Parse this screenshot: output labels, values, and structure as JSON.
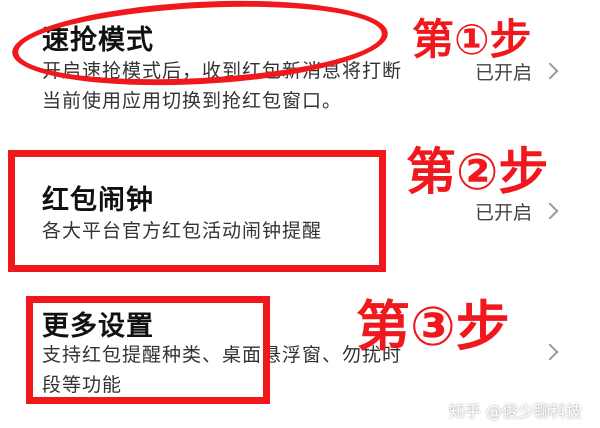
{
  "settings": {
    "items": [
      {
        "title": "速抢模式",
        "desc_line1": "开启速抢模式后，收到红包新消息将打断",
        "desc_line2": "当前使用应用切换到抢红包窗口。",
        "status": "已开启"
      },
      {
        "title": "红包闹钟",
        "desc_line1": "各大平台官方红包活动闹钟提醒",
        "status": "已开启"
      },
      {
        "title": "更多设置",
        "desc_line1": "支持红包提醒种类、桌面悬浮窗、勿扰时",
        "desc_line2": "段等功能"
      }
    ]
  },
  "annotations": {
    "step1": "第①步",
    "step2": "第②步",
    "step3": "第③步",
    "highlight_color": "#f0181c"
  },
  "watermark": "知乎 @俊少聊科技"
}
